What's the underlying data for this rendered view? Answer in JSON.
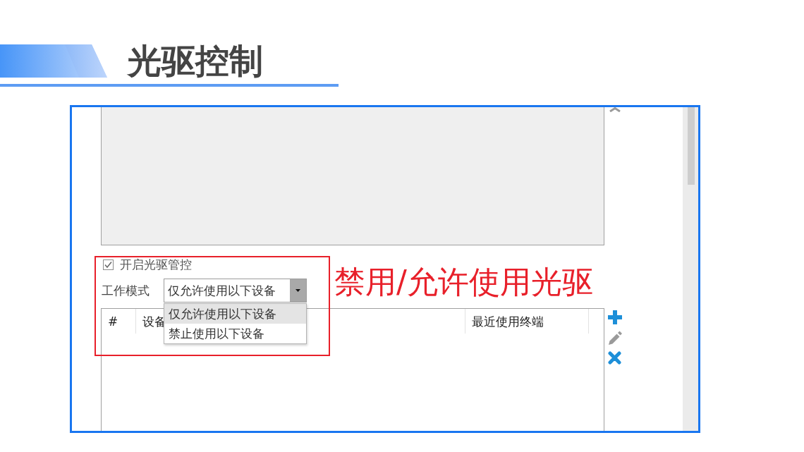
{
  "slide": {
    "title": "光驱控制"
  },
  "screen": {
    "enable_control": {
      "label": "开启光驱管控",
      "checked": true
    },
    "work_mode": {
      "label": "工作模式",
      "value": "仅允许使用以下设备",
      "expanded": true,
      "options": [
        {
          "label": "仅允许使用以下设备",
          "selected": true
        },
        {
          "label": "禁止使用以下设备",
          "selected": false
        }
      ]
    },
    "table": {
      "columns": [
        "#",
        "设备",
        "最近使用终端"
      ]
    }
  },
  "annotation": {
    "text": "禁用/允许使用光驱"
  }
}
